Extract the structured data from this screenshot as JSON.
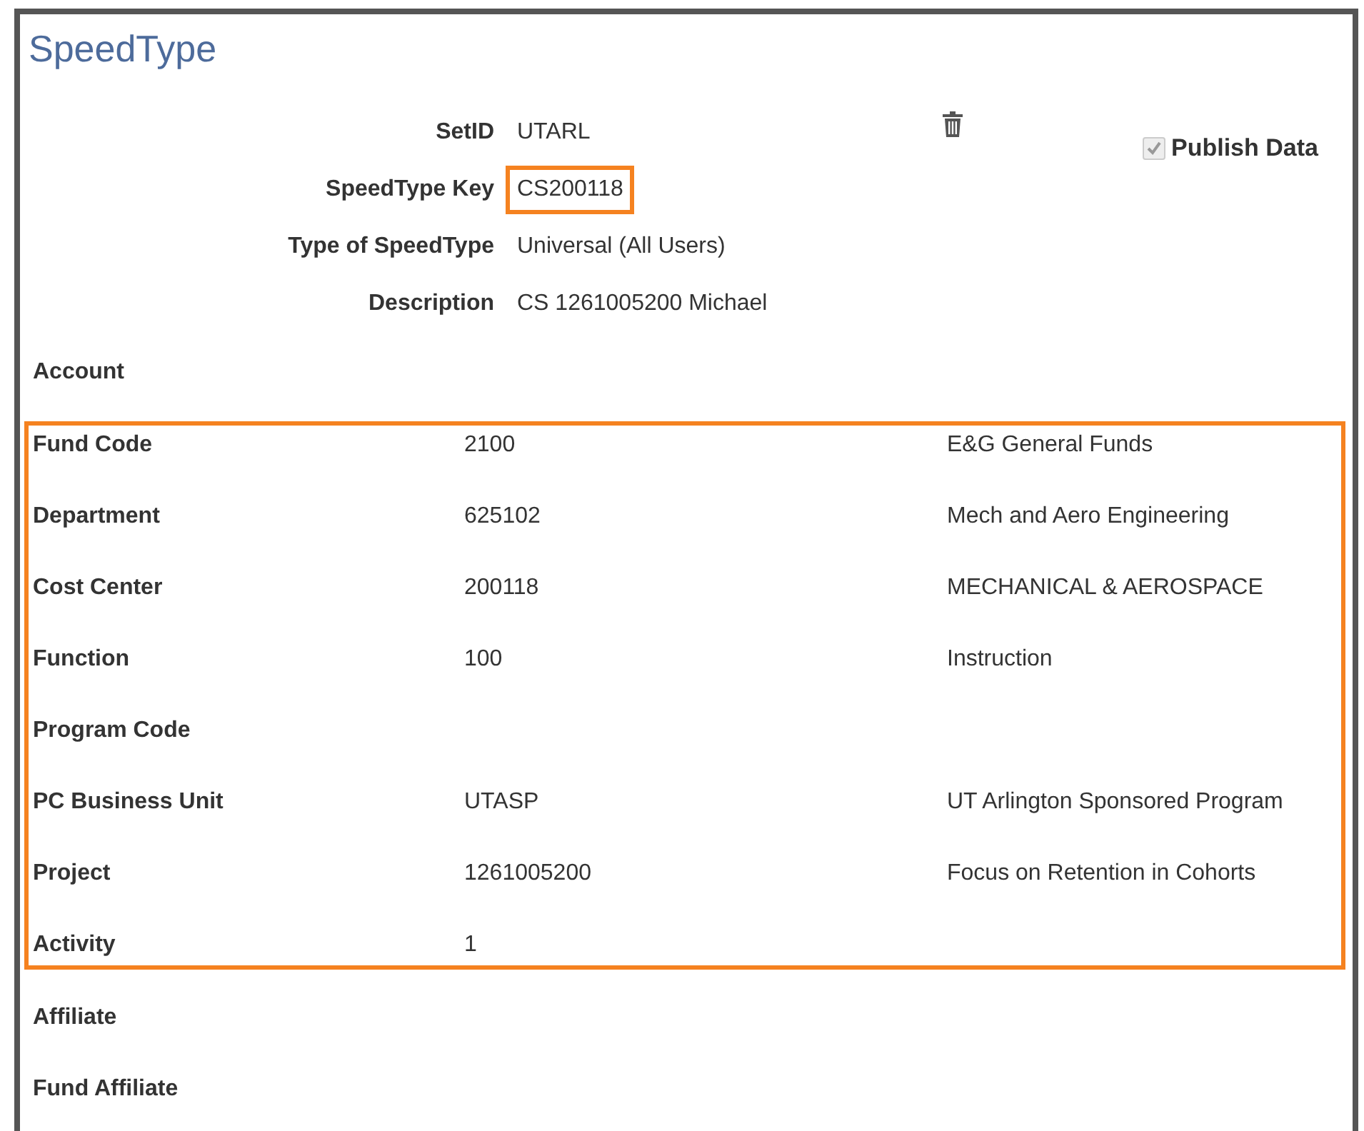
{
  "title": "SpeedType",
  "header_fields": [
    {
      "label": "SetID",
      "value": "UTARL",
      "highlighted": false
    },
    {
      "label": "SpeedType Key",
      "value": "CS200118",
      "highlighted": true
    },
    {
      "label": "Type of SpeedType",
      "value": "Universal (All Users)",
      "highlighted": false
    },
    {
      "label": "Description",
      "value": "CS 1261005200 Michael",
      "highlighted": false
    }
  ],
  "publish_data": {
    "label": "Publish Data",
    "checked": true,
    "disabled": true
  },
  "groups": [
    {
      "highlighted": false,
      "rows": [
        {
          "label": "Account"
        }
      ]
    },
    {
      "highlighted": true,
      "rows": [
        {
          "label": "Fund Code",
          "code": "2100",
          "description": "E&G General Funds"
        },
        {
          "label": "Department",
          "code": "625102",
          "description": "Mech and Aero Engineering"
        },
        {
          "label": "Cost Center",
          "code": "200118",
          "description": "MECHANICAL & AEROSPACE"
        },
        {
          "label": "Function",
          "code": "100",
          "description": "Instruction"
        },
        {
          "label": "Program Code"
        },
        {
          "label": "PC Business Unit",
          "code": "UTASP",
          "description": "UT Arlington Sponsored Program"
        },
        {
          "label": "Project",
          "code": "1261005200",
          "description": "Focus on Retention in Cohorts"
        },
        {
          "label": "Activity",
          "code": "1"
        }
      ]
    },
    {
      "highlighted": false,
      "rows": [
        {
          "label": "Affiliate"
        },
        {
          "label": "Fund Affiliate"
        }
      ]
    }
  ]
}
